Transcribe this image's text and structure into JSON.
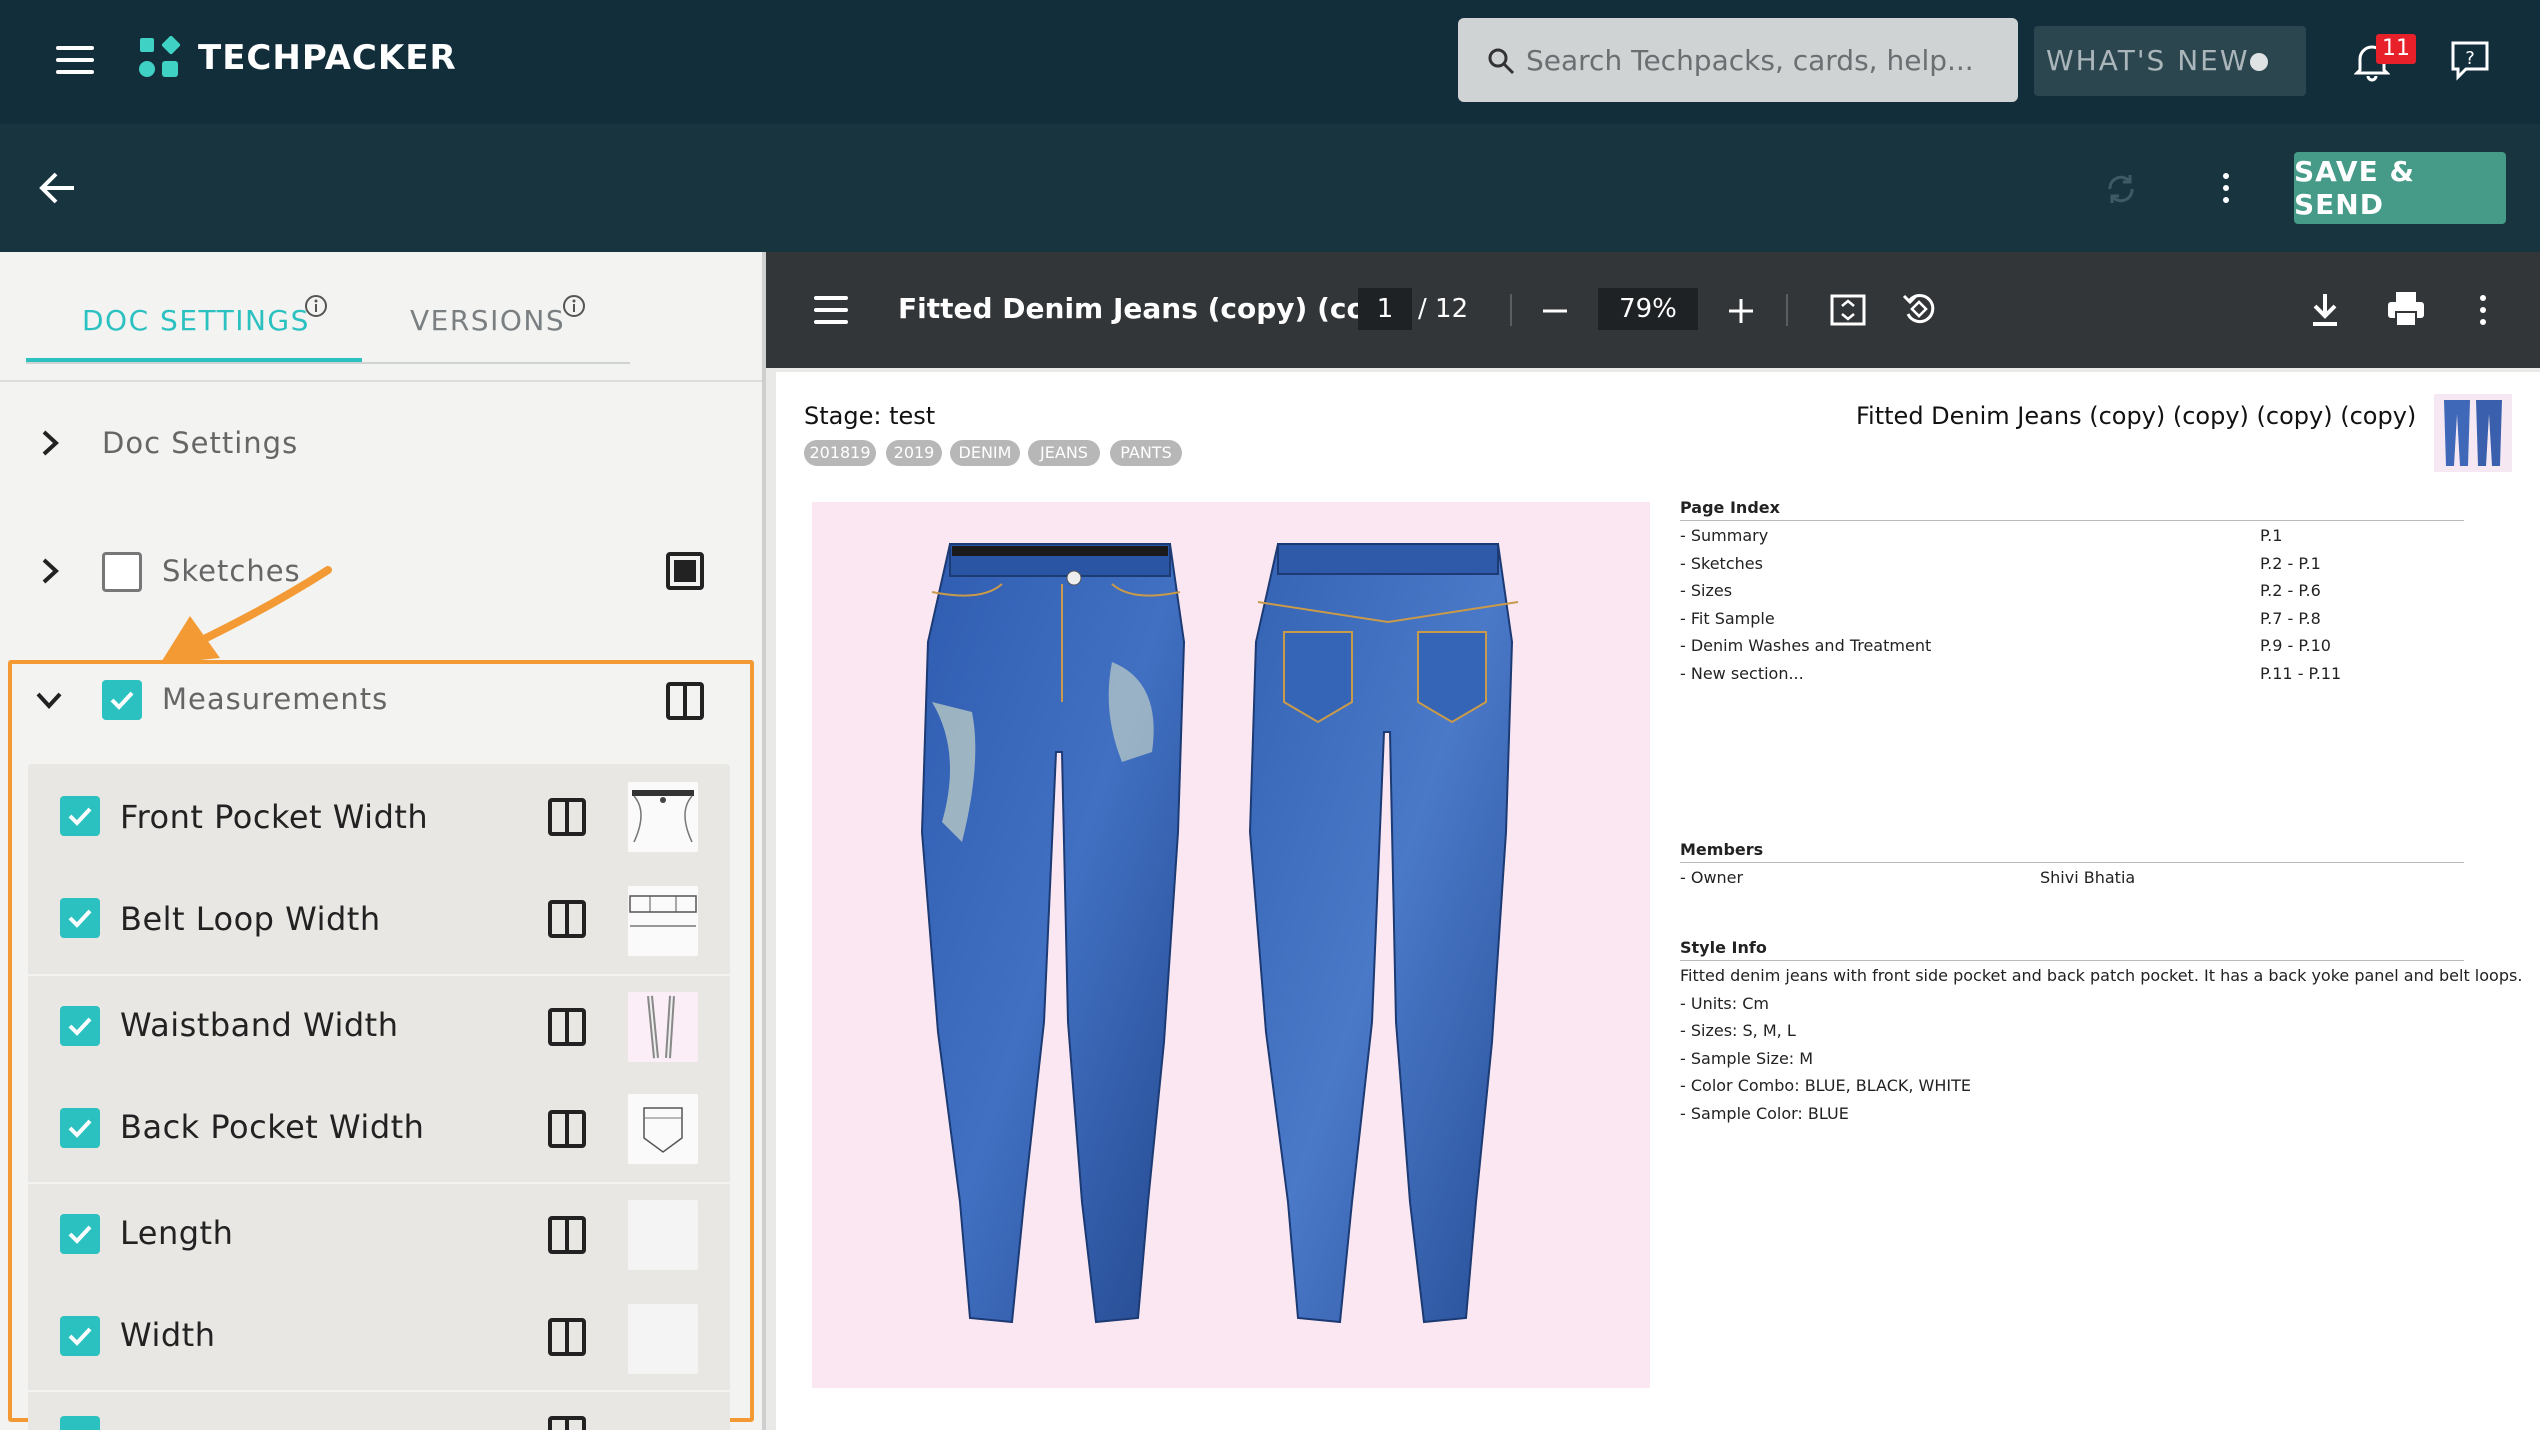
{
  "app": {
    "brand": "TECHPACKER"
  },
  "header": {
    "search_placeholder": "Search Techpacks, cards, help...",
    "whats_new": "WHAT'S NEW",
    "notification_count": "11"
  },
  "subheader": {
    "save_label": "SAVE & SEND"
  },
  "sidebar": {
    "tabs": [
      {
        "label": "DOC SETTINGS",
        "active": true
      },
      {
        "label": "VERSIONS",
        "active": false
      }
    ],
    "sections": [
      {
        "label": "Doc Settings"
      },
      {
        "label": "Sketches",
        "checked": false
      },
      {
        "label": "Measurements",
        "checked": true
      }
    ],
    "measurements": [
      {
        "label": "Front Pocket Width",
        "checked": true
      },
      {
        "label": "Belt Loop Width",
        "checked": true
      },
      {
        "label": "Waistband Width",
        "checked": true
      },
      {
        "label": "Back Pocket Width",
        "checked": true
      },
      {
        "label": "Length",
        "checked": true
      },
      {
        "label": "Width",
        "checked": true
      }
    ]
  },
  "viewer": {
    "doc_title": "Fitted Denim Jeans (copy) (co...",
    "page_current": "1",
    "page_total": "/ 12",
    "zoom": "79%"
  },
  "document": {
    "stage": "Stage: test",
    "title": "Fitted Denim Jeans (copy) (copy) (copy) (copy)",
    "tags": [
      "201819",
      "2019",
      "DENIM",
      "JEANS",
      "PANTS"
    ],
    "page_index": {
      "heading": "Page Index",
      "rows": [
        {
          "name": "- Summary",
          "page": "P.1"
        },
        {
          "name": "- Sketches",
          "page": "P.2 - P.1"
        },
        {
          "name": "- Sizes",
          "page": "P.2 - P.6"
        },
        {
          "name": "- Fit Sample",
          "page": "P.7 - P.8"
        },
        {
          "name": "- Denim Washes and Treatment",
          "page": "P.9 - P.10"
        },
        {
          "name": "- New section...",
          "page": "P.11 - P.11"
        }
      ]
    },
    "members": {
      "heading": "Members",
      "role": "- Owner",
      "name": "Shivi Bhatia"
    },
    "style_info": {
      "heading": "Style Info",
      "lines": [
        "Fitted denim jeans with front side pocket and back patch pocket. It has a back yoke panel and belt loops.",
        "- Units: Cm",
        "- Sizes: S, M, L",
        "- Sample Size: M",
        "- Color Combo: BLUE, BLACK, WHITE",
        "- Sample Color: BLUE"
      ]
    }
  },
  "colors": {
    "topbar": "#132e3b",
    "accent": "#2cc1c1",
    "save": "#459a88",
    "highlight": "#f39a34",
    "badge": "#e8202a"
  }
}
